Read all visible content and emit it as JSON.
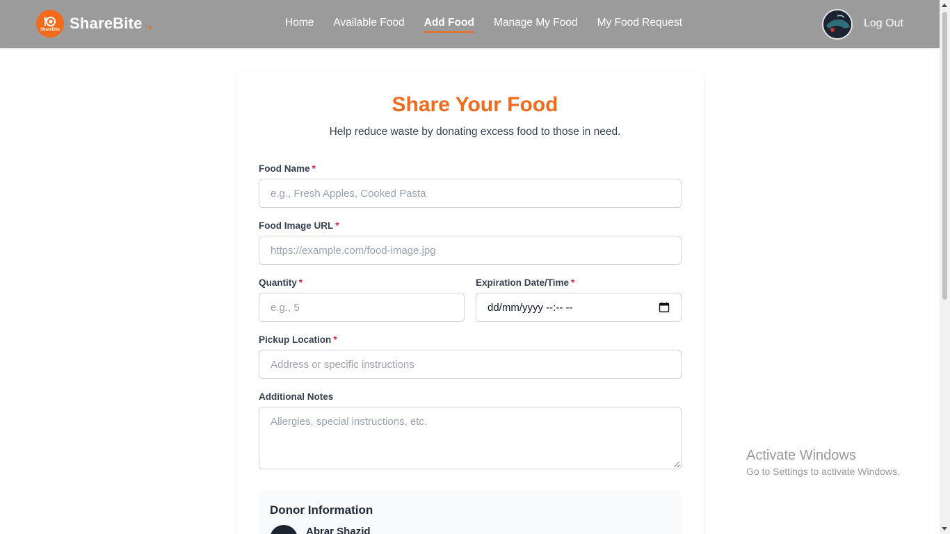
{
  "navbar": {
    "brand": "ShareBite",
    "brand_dot": ".",
    "badge_text": "ShareBite",
    "links": [
      {
        "label": "Home",
        "active": false
      },
      {
        "label": "Available Food",
        "active": false
      },
      {
        "label": "Add Food",
        "active": true
      },
      {
        "label": "Manage My Food",
        "active": false
      },
      {
        "label": "My Food Request",
        "active": false
      }
    ],
    "logout": "Log Out",
    "accent": "#f26b1d"
  },
  "form": {
    "title": "Share Your Food",
    "subtitle": "Help reduce waste by donating excess food to those in need.",
    "required_mark": "*",
    "fields": {
      "food_name": {
        "label": "Food Name",
        "placeholder": "e.g., Fresh Apples, Cooked Pasta"
      },
      "image_url": {
        "label": "Food Image URL",
        "placeholder": "https://example.com/food-image.jpg"
      },
      "quantity": {
        "label": "Quantity",
        "placeholder": "e.g., 5"
      },
      "expiration": {
        "label": "Expiration Date/Time",
        "value": "dd/mm/yyyy --:-- --"
      },
      "pickup": {
        "label": "Pickup Location",
        "placeholder": "Address or specific instructions"
      },
      "notes": {
        "label": "Additional Notes",
        "placeholder": "Allergies, special instructions, etc."
      }
    },
    "donor": {
      "title": "Donor Information",
      "name": "Abrar Shazid"
    }
  },
  "watermark": {
    "line1": "Activate Windows",
    "line2": "Go to Settings to activate Windows."
  }
}
